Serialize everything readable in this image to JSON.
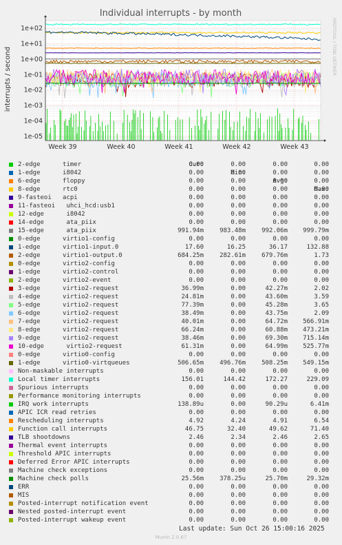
{
  "chart_data": {
    "type": "line",
    "title": "Individual interrupts - by month",
    "ylabel": "interrupts / second",
    "y_scale": "log",
    "ylim": [
      5e-06,
      300
    ],
    "y_ticks": [
      "1e+02",
      "1e+01",
      "1e+00",
      "1e-01",
      "1e-02",
      "1e-03",
      "1e-04",
      "1e-05"
    ],
    "x_ticks": [
      "Week 39",
      "Week 40",
      "Week 41",
      "Week 42",
      "Week 43"
    ],
    "grid": true,
    "side_text": "RRDTOOL / TOBI OETIKER",
    "columns": [
      "Cur:",
      "Min:",
      "Avg:",
      "Max:"
    ],
    "series": [
      {
        "name": "2-edge      timer",
        "color": "#00cc00",
        "cur": "0.00",
        "min": "0.00",
        "avg": "0.00",
        "max": "0.00"
      },
      {
        "name": "1-edge      i8042",
        "color": "#0066b3",
        "cur": "0.00",
        "min": "0.00",
        "avg": "0.00",
        "max": "0.00"
      },
      {
        "name": "6-edge      floppy",
        "color": "#ff8000",
        "cur": "0.00",
        "min": "0.00",
        "avg": "0.00",
        "max": "0.00"
      },
      {
        "name": "8-edge      rtc0",
        "color": "#ffcc00",
        "cur": "0.00",
        "min": "0.00",
        "avg": "0.00",
        "max": "0.00"
      },
      {
        "name": "9-fasteoi   acpi",
        "color": "#330099",
        "cur": "0.00",
        "min": "0.00",
        "avg": "0.00",
        "max": "0.00"
      },
      {
        "name": "11-fasteoi   uhci_hcd:usb1",
        "color": "#990099",
        "cur": "0.00",
        "min": "0.00",
        "avg": "0.00",
        "max": "0.00"
      },
      {
        "name": "12-edge      i8042",
        "color": "#ccff00",
        "cur": "0.00",
        "min": "0.00",
        "avg": "0.00",
        "max": "0.00"
      },
      {
        "name": "14-edge      ata_piix",
        "color": "#ff0000",
        "cur": "0.00",
        "min": "0.00",
        "avg": "0.00",
        "max": "0.00"
      },
      {
        "name": "15-edge      ata_piix",
        "color": "#808080",
        "cur": "991.94m",
        "min": "983.48m",
        "avg": "992.06m",
        "max": "999.79m"
      },
      {
        "name": "0-edge      virtio1-config",
        "color": "#008f00",
        "cur": "0.00",
        "min": "0.00",
        "avg": "0.00",
        "max": "0.00"
      },
      {
        "name": "1-edge      virtio1-input.0",
        "color": "#00487d",
        "cur": "17.60",
        "min": "16.25",
        "avg": "36.17",
        "max": "132.88"
      },
      {
        "name": "2-edge      virtio1-output.0",
        "color": "#b35a00",
        "cur": "684.25m",
        "min": "282.61m",
        "avg": "679.76m",
        "max": "1.73"
      },
      {
        "name": "0-edge      virtio2-config",
        "color": "#b38f00",
        "cur": "0.00",
        "min": "0.00",
        "avg": "0.00",
        "max": "0.00"
      },
      {
        "name": "1-edge      virtio2-control",
        "color": "#6b006b",
        "cur": "0.00",
        "min": "0.00",
        "avg": "0.00",
        "max": "0.00"
      },
      {
        "name": "2-edge      virtio2-event",
        "color": "#8fb300",
        "cur": "0.00",
        "min": "0.00",
        "avg": "0.00",
        "max": "0.00"
      },
      {
        "name": "3-edge      virtio2-request",
        "color": "#b30000",
        "cur": "36.99m",
        "min": "0.00",
        "avg": "42.27m",
        "max": "2.02"
      },
      {
        "name": "4-edge      virtio2-request",
        "color": "#bebebe",
        "cur": "24.81m",
        "min": "0.00",
        "avg": "43.60m",
        "max": "3.59"
      },
      {
        "name": "5-edge      virtio2-request",
        "color": "#80ff80",
        "cur": "77.39m",
        "min": "0.00",
        "avg": "45.28m",
        "max": "3.65"
      },
      {
        "name": "6-edge      virtio2-request",
        "color": "#80c9ff",
        "cur": "38.49m",
        "min": "0.00",
        "avg": "43.75m",
        "max": "2.09"
      },
      {
        "name": "7-edge      virtio2-request",
        "color": "#ffc080",
        "cur": "40.01m",
        "min": "0.00",
        "avg": "64.72m",
        "max": "566.91m"
      },
      {
        "name": "8-edge      virtio2-request",
        "color": "#ffe680",
        "cur": "66.24m",
        "min": "0.00",
        "avg": "60.88m",
        "max": "473.21m"
      },
      {
        "name": "9-edge      virtio2-request",
        "color": "#aa80ff",
        "cur": "38.46m",
        "min": "0.00",
        "avg": "69.30m",
        "max": "715.14m"
      },
      {
        "name": "10-edge      virtio2-request",
        "color": "#ee00cc",
        "cur": "61.31m",
        "min": "0.00",
        "avg": "64.99m",
        "max": "525.77m"
      },
      {
        "name": "0-edge      virtio0-config",
        "color": "#ff8080",
        "cur": "0.00",
        "min": "0.00",
        "avg": "0.00",
        "max": "0.00"
      },
      {
        "name": "1-edge      virtio0-virtqueues",
        "color": "#666600",
        "cur": "506.65m",
        "min": "496.76m",
        "avg": "508.25m",
        "max": "549.15m"
      },
      {
        "name": "Non-maskable interrupts",
        "color": "#ffbfff",
        "cur": "0.00",
        "min": "0.00",
        "avg": "0.00",
        "max": "0.00"
      },
      {
        "name": "Local timer interrupts",
        "color": "#00ffcc",
        "cur": "156.01",
        "min": "144.42",
        "avg": "172.27",
        "max": "229.09"
      },
      {
        "name": "Spurious interrupts",
        "color": "#cc6699",
        "cur": "0.00",
        "min": "0.00",
        "avg": "0.00",
        "max": "0.00"
      },
      {
        "name": "Performance monitoring interrupts",
        "color": "#999900",
        "cur": "0.00",
        "min": "0.00",
        "avg": "0.00",
        "max": "0.00"
      },
      {
        "name": "IRQ work interrupts",
        "color": "#00cc00",
        "cur": "138.89u",
        "min": "0.00",
        "avg": "90.29u",
        "max": "6.41m"
      },
      {
        "name": "APIC ICR read retries",
        "color": "#0066b3",
        "cur": "0.00",
        "min": "0.00",
        "avg": "0.00",
        "max": "0.00"
      },
      {
        "name": "Rescheduling interrupts",
        "color": "#ff8000",
        "cur": "4.92",
        "min": "4.24",
        "avg": "4.91",
        "max": "6.54"
      },
      {
        "name": "Function call interrupts",
        "color": "#ffcc00",
        "cur": "46.75",
        "min": "32.40",
        "avg": "49.62",
        "max": "71.40"
      },
      {
        "name": "TLB shootdowns",
        "color": "#330099",
        "cur": "2.46",
        "min": "2.34",
        "avg": "2.46",
        "max": "2.65"
      },
      {
        "name": "Thermal event interrupts",
        "color": "#990099",
        "cur": "0.00",
        "min": "0.00",
        "avg": "0.00",
        "max": "0.00"
      },
      {
        "name": "Threshold APIC interrupts",
        "color": "#ccff00",
        "cur": "0.00",
        "min": "0.00",
        "avg": "0.00",
        "max": "0.00"
      },
      {
        "name": "Deferred Error APIC interrupts",
        "color": "#ff0000",
        "cur": "0.00",
        "min": "0.00",
        "avg": "0.00",
        "max": "0.00"
      },
      {
        "name": "Machine check exceptions",
        "color": "#808080",
        "cur": "0.00",
        "min": "0.00",
        "avg": "0.00",
        "max": "0.00"
      },
      {
        "name": "Machine check polls",
        "color": "#008f00",
        "cur": "25.56m",
        "min": "378.25u",
        "avg": "25.70m",
        "max": "29.32m"
      },
      {
        "name": "ERR",
        "color": "#00487d",
        "cur": "0.00",
        "min": "0.00",
        "avg": "0.00",
        "max": "0.00"
      },
      {
        "name": "MIS",
        "color": "#b35a00",
        "cur": "0.00",
        "min": "0.00",
        "avg": "0.00",
        "max": "0.00"
      },
      {
        "name": "Posted-interrupt notification event",
        "color": "#b38f00",
        "cur": "0.00",
        "min": "0.00",
        "avg": "0.00",
        "max": "0.00"
      },
      {
        "name": "Nested posted-interrupt event",
        "color": "#6b006b",
        "cur": "0.00",
        "min": "0.00",
        "avg": "0.00",
        "max": "0.00"
      },
      {
        "name": "Posted-interrupt wakeup event",
        "color": "#8fb300",
        "cur": "0.00",
        "min": "0.00",
        "avg": "0.00",
        "max": "0.00"
      }
    ]
  },
  "footer": {
    "last_update": "Last update: Sun Oct 26 15:00:16 2025",
    "munin": "Munin 2.0.67"
  }
}
